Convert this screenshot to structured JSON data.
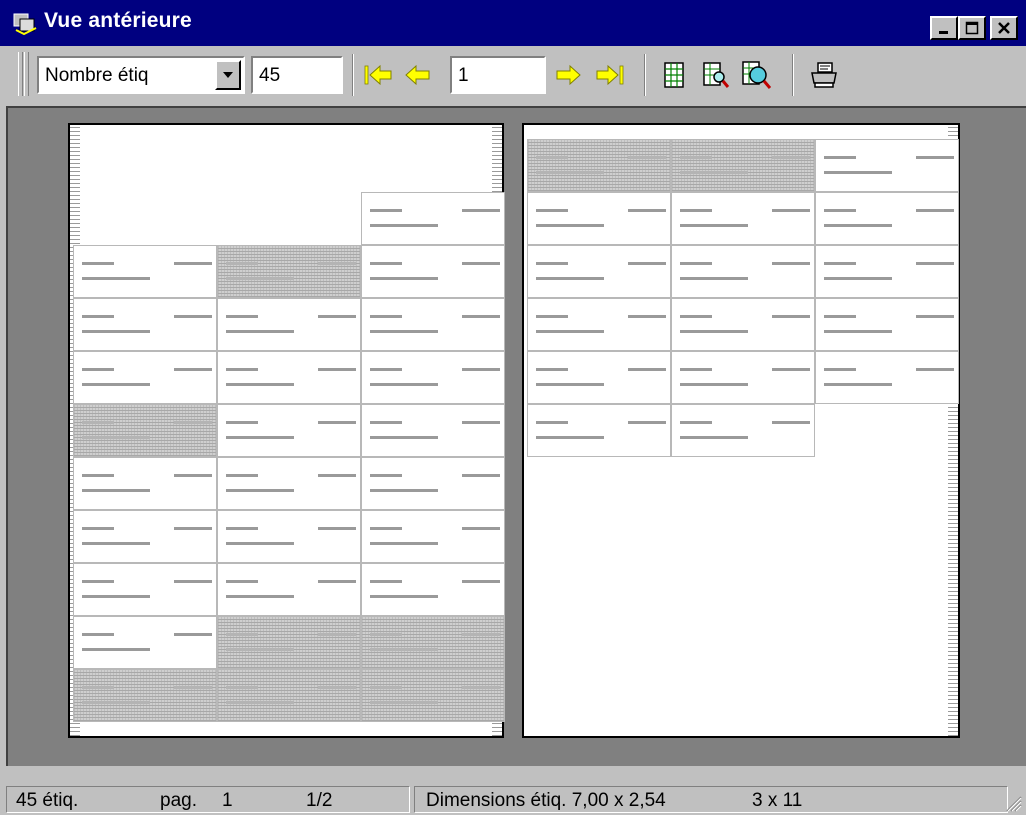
{
  "window": {
    "title": "Vue antérieure"
  },
  "toolbar": {
    "mode_select": "Nombre étiq",
    "count_value": "45",
    "page_value": "1"
  },
  "status": {
    "labels": "45 étiq.",
    "page_label": "pag.",
    "page_number": "1",
    "page_of": "1/2",
    "dimensions": "Dimensions étiq. 7,00 x 2,54",
    "layout": "3 x 11"
  },
  "icons": [
    "app-icon",
    "minimize-icon",
    "maximize-icon",
    "close-icon",
    "dropdown-arrow-icon",
    "first-page-icon",
    "previous-page-icon",
    "next-page-icon",
    "last-page-icon",
    "grid-layout-icon",
    "zoom-page-icon",
    "zoom-in-icon",
    "print-icon"
  ]
}
